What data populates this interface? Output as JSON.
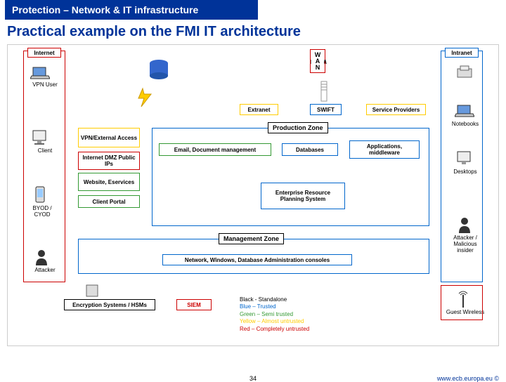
{
  "header": "Protection – Network & IT infrastructure",
  "title": "Practical example on the FMI IT architecture",
  "page_num": "34",
  "url": "www.ecb.europa.eu ©",
  "zones": {
    "internet": "Internet",
    "intranet": "Intranet",
    "prod": "Production Zone",
    "mgmt": "Management Zone"
  },
  "labels": {
    "wan": "WAN",
    "extranet": "Extranet",
    "swift": "SWIFT",
    "sp": "Service Providers",
    "vpn": "VPN/External Access",
    "dmz": "Internet DMZ Public IPs",
    "web": "Website, Eservices",
    "portal": "Client Portal",
    "email": "Email, Document management",
    "db": "Databases",
    "apps": "Applications, middleware",
    "erp": "Enterprise Resource Planning System",
    "admin": "Network, Windows, Database Administration consoles",
    "siem": "SIEM",
    "hsm": "Encryption Systems / HSMs",
    "vpnuser": "VPN User",
    "client": "Client",
    "byod": "BYOD / CYOD",
    "attacker": "Attacker",
    "notebooks": "Notebooks",
    "desktops": "Desktops",
    "attacker2": "Attacker / Malicious insider",
    "wireless": "Guest Wireless"
  },
  "legend": {
    "black": "Black - Standalone",
    "blue": "Blue – Trusted",
    "green": "Green – Semi trusted",
    "yellow": "Yellow – Almost untrusted",
    "red": "Red – Completely untrusted"
  },
  "colors": {
    "red": "#cc0000",
    "blue": "#0066cc",
    "green": "#339933",
    "yellow": "#ffcc00",
    "black": "#000"
  }
}
